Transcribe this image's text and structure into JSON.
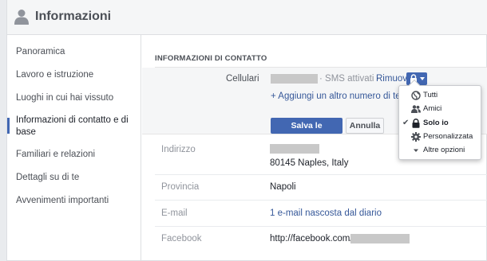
{
  "header": {
    "title": "Informazioni",
    "icon": "person-icon"
  },
  "sidebar": {
    "items": [
      {
        "label": "Panoramica"
      },
      {
        "label": "Lavoro e istruzione"
      },
      {
        "label": "Luoghi in cui hai vissuto"
      },
      {
        "label": "Informazioni di contatto e di base",
        "active": true
      },
      {
        "label": "Familiari e relazioni"
      },
      {
        "label": "Dettagli su di te"
      },
      {
        "label": "Avvenimenti importanti"
      }
    ]
  },
  "contact": {
    "section_title": "INFORMAZIONI DI CONTATTO",
    "cell_label": "Cellulari",
    "sms_status": "· SMS attivati ·",
    "remove_label": "Rimuovi",
    "add_phone_label": "+ Aggiungi un altro numero di telefono",
    "save_label": "Salva le modifiche",
    "cancel_label": "Annulla",
    "address_label": "Indirizzo",
    "address_city": "80145 Naples, Italy",
    "province_label": "Provincia",
    "province_value": "Napoli",
    "email_label": "E-mail",
    "email_value": "1 e-mail nascosta dal diario",
    "facebook_label": "Facebook",
    "facebook_value": "http://facebook.com/"
  },
  "privacy_menu": {
    "items": [
      {
        "label": "Tutti",
        "icon": "globe-icon"
      },
      {
        "label": "Amici",
        "icon": "friends-icon"
      },
      {
        "label": "Solo io",
        "icon": "lock-icon",
        "selected": true
      },
      {
        "label": "Personalizzata",
        "icon": "gear-icon"
      },
      {
        "label": "Altre opzioni",
        "icon": "caret-down-icon"
      }
    ]
  },
  "colors": {
    "accent": "#4267b2",
    "link": "#365899",
    "muted": "#90949c",
    "redaction": "#c8c8c8"
  }
}
